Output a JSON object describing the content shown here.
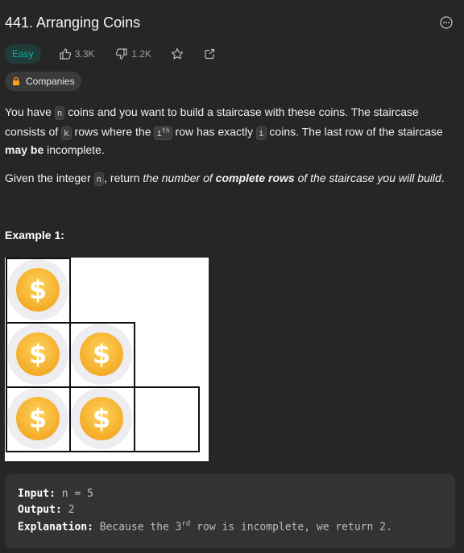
{
  "problem": {
    "title": "441. Arranging Coins",
    "difficulty": "Easy",
    "likes": "3.3K",
    "dislikes": "1.2K",
    "companies_label": "Companies"
  },
  "description": {
    "p1_a": "You have ",
    "p1_code_n": "n",
    "p1_b": " coins and you want to build a staircase with these coins. The staircase consists of ",
    "p1_code_k": "k",
    "p1_c": " rows where the ",
    "p1_code_i": "i",
    "p1_code_th": "th",
    "p1_d": " row has exactly ",
    "p1_code_i2": "i",
    "p1_e": " coins. The last row of the staircase ",
    "p1_bold": "may be",
    "p1_f": " incomplete.",
    "p2_a": "Given the integer ",
    "p2_code_n": "n",
    "p2_b": ", return ",
    "p2_italic_a": "the number of ",
    "p2_bold_italic": "complete rows",
    "p2_italic_b": " of the staircase you will build",
    "p2_end": "."
  },
  "example": {
    "title": "Example 1:",
    "input_label": "Input:",
    "input_value": " n = 5",
    "output_label": "Output:",
    "output_value": " 2",
    "explanation_label": "Explanation:",
    "explanation_a": " Because the 3",
    "explanation_sup": "rd",
    "explanation_b": " row is incomplete, we return 2.",
    "coin_symbol": "$",
    "coin_color": "#f8bb31"
  }
}
